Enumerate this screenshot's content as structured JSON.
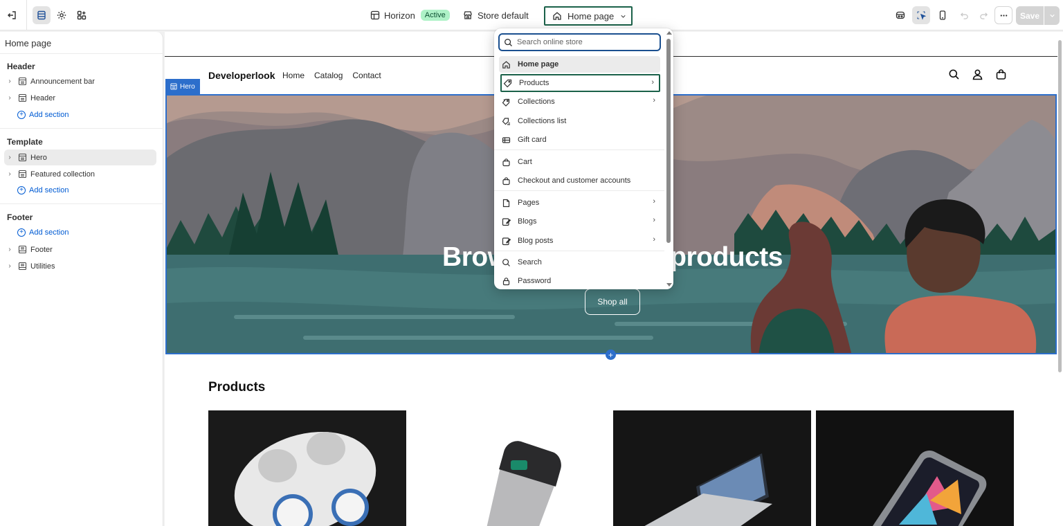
{
  "topbar": {
    "theme_name": "Horizon",
    "theme_status": "Active",
    "store_name": "Store default",
    "page_selector": "Home page",
    "save_label": "Save"
  },
  "sidebar": {
    "title": "Home page",
    "groups": {
      "header": "Header",
      "template": "Template",
      "footer": "Footer"
    },
    "items": {
      "announcement": "Announcement bar",
      "header": "Header",
      "hero": "Hero",
      "featured": "Featured collection",
      "footer": "Footer",
      "utilities": "Utilities"
    },
    "add_section": "Add section"
  },
  "preview": {
    "brand": "Developerlook",
    "nav": [
      "Home",
      "Catalog",
      "Contact"
    ],
    "hero_tag": "Hero",
    "hero_heading": "Browse our latest products",
    "hero_button": "Shop all",
    "products_title": "Products"
  },
  "dropdown": {
    "search_placeholder": "Search online store",
    "items": [
      {
        "label": "Home page",
        "icon": "home-icon"
      },
      {
        "label": "Products",
        "icon": "tag-icon"
      },
      {
        "label": "Collections",
        "icon": "collection-icon"
      },
      {
        "label": "Collections list",
        "icon": "collection-list-icon"
      },
      {
        "label": "Gift card",
        "icon": "gift-card-icon"
      },
      {
        "label": "Cart",
        "icon": "bag-icon"
      },
      {
        "label": "Checkout and customer accounts",
        "icon": "bag-icon"
      },
      {
        "label": "Pages",
        "icon": "page-icon"
      },
      {
        "label": "Blogs",
        "icon": "blog-icon"
      },
      {
        "label": "Blog posts",
        "icon": "blog-icon"
      },
      {
        "label": "Search",
        "icon": "search-icon"
      },
      {
        "label": "Password",
        "icon": "lock-icon"
      }
    ]
  },
  "colors": {
    "accent_blue": "#2c6ecb",
    "focus_green": "#1a6149",
    "active_badge": "#aef2c7",
    "link_blue": "#005bd3"
  }
}
